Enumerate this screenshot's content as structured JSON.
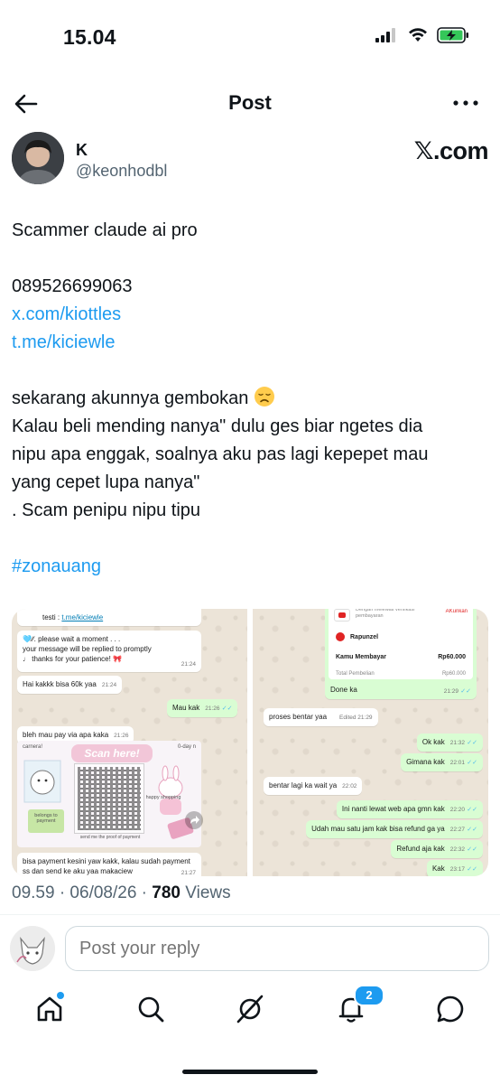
{
  "status_bar": {
    "time": "15.04",
    "icons": [
      "signal-icon",
      "wifi-icon",
      "battery-charging-icon"
    ]
  },
  "header": {
    "title": "Post",
    "back_icon": "arrow-left-icon",
    "more_icon": "more-icon"
  },
  "author": {
    "name": "K",
    "handle": "@keonhodbl",
    "watermark": "𝕏.com"
  },
  "post": {
    "line1": "Scammer claude ai pro",
    "phone": "089526699063",
    "link1": "x.com/kiottles",
    "link2": "t.me/kiciewle",
    "line_locked": "sekarang akunnya gembokan",
    "line_advice_1": "Kalau beli mending nanya\" dulu ges biar ngetes dia",
    "line_advice_2": "nipu apa enggak, soalnya aku pas lagi kepepet mau",
    "line_advice_3": "yang cepet lupa nanya\"",
    "line_scam": ". Scam penipu nipu tipu",
    "hashtag": "#zonauang"
  },
  "media": {
    "left_chat": {
      "testi_label": "testi :",
      "testi_link": "t.me/kiciewle",
      "auto_reply_1": "🩵∕∕. please wait a moment . . .",
      "auto_reply_2": "your message will be replied to promptly",
      "auto_reply_3": "♩ thanks for your patience! 🎀",
      "auto_reply_time": "21:24",
      "msg1": "Hai kakkk bisa 60k yaa",
      "msg1_time": "21:24",
      "msg2": "Mau kak",
      "msg2_time": "21:26",
      "msg3": "bleh mau pay via apa kaka",
      "msg3_time": "21:26",
      "qr_title": "Scan here!",
      "qr_corner_tl": "carnera!",
      "qr_corner_tr": "0-day n",
      "qr_left_text": "belongs to payment",
      "qr_right_text": "happy shopping",
      "qr_bottom_text": "send me the proof of payment",
      "msg4_1": "bisa payment kesini yaw kakk, kalau sudah payment",
      "msg4_2": "ss dan send ke aku yaa makaciew",
      "msg4_time": "21:27"
    },
    "right_chat": {
      "pay_note": "Dengan melewati verifikasi pembayaran",
      "pay_badge": "AKunkan",
      "merchant": "Rapunzel",
      "pay_label": "Kamu Membayar",
      "pay_amount": "Rp60.000",
      "total_label": "Total Pembelian",
      "total_amount": "Rp60.000",
      "msg_done": "Done ka",
      "msg_done_time": "21:29",
      "msg_process": "proses bentar yaa",
      "msg_process_time": "Edited 21:29",
      "msg_ok": "Ok kak",
      "msg_ok_time": "21:32",
      "msg_gimana": "Gimana kak",
      "msg_gimana_time": "22:01",
      "msg_wait": "bentar lagi ka wait ya",
      "msg_wait_time": "22:02",
      "msg_web": "Ini nanti lewat web apa gmn kak",
      "msg_web_time": "22:20",
      "msg_refund_q": "Udah mau satu jam kak bisa refund ga ya",
      "msg_refund_q_time": "22:27",
      "msg_refund": "Refund aja kak",
      "msg_refund_time": "22:32",
      "msg_kak": "Kak",
      "msg_kak_time": "23:17"
    }
  },
  "meta": {
    "datetime": "09.59 · 06/08/26 ·",
    "views_count": "780",
    "views_label": "Views"
  },
  "reply": {
    "placeholder": "Post your reply"
  },
  "bottom_nav": {
    "items": [
      "home-icon",
      "search-icon",
      "grok-icon",
      "notifications-icon",
      "messages-icon"
    ],
    "notifications_badge": "2"
  },
  "colors": {
    "accent": "#1d9bf0",
    "text": "#0f1419",
    "secondary": "#536471",
    "wa_bg": "#ece4d8",
    "wa_out": "#d9fdd3"
  }
}
